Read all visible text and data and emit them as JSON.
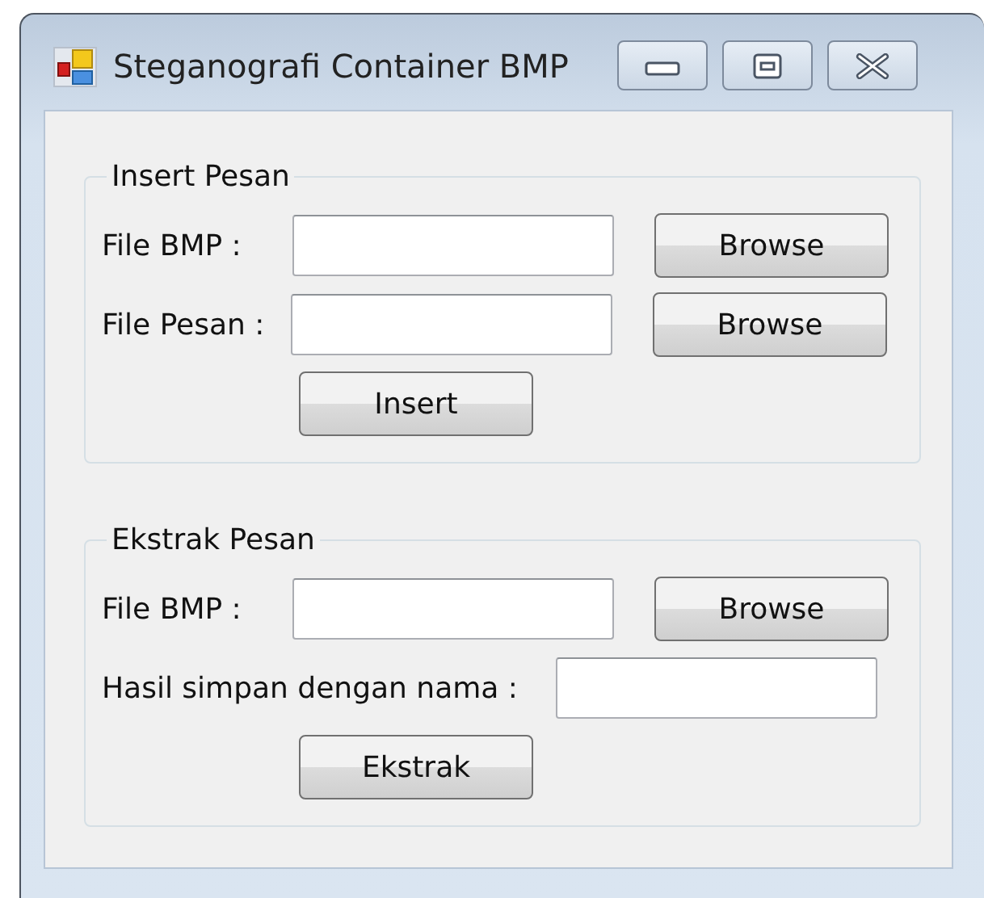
{
  "window": {
    "title": "Steganografi Container BMP"
  },
  "groups": [
    {
      "title": "Insert Pesan",
      "rows": [
        {
          "label": "File BMP :",
          "button": "Browse"
        },
        {
          "label": "File Pesan :",
          "button": "Browse"
        }
      ],
      "action": "Insert"
    },
    {
      "title": "Ekstrak Pesan",
      "rows": [
        {
          "label": "File BMP :",
          "button": "Browse"
        },
        {
          "label": "Hasil simpan dengan nama :"
        }
      ],
      "action": "Ekstrak"
    }
  ]
}
